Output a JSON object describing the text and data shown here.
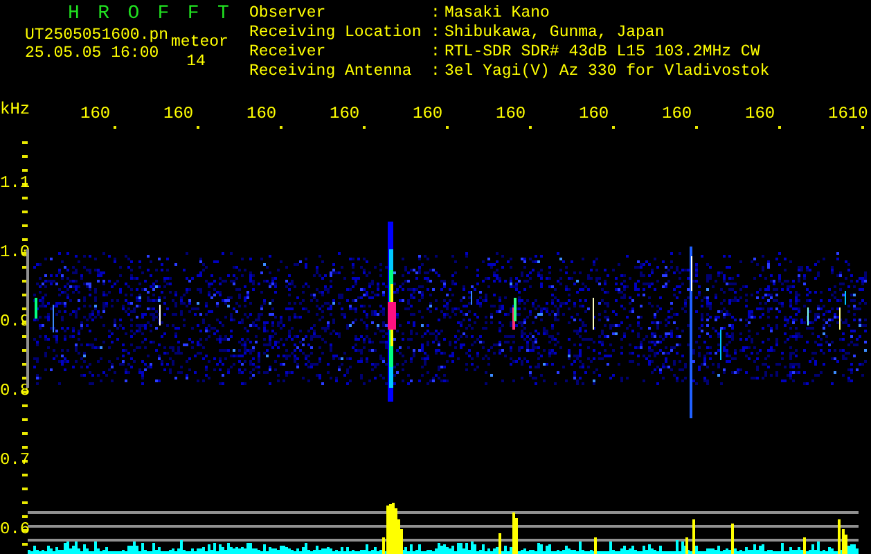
{
  "header": {
    "title": "H R O F F T",
    "file": "UT2505051600.pn",
    "mode": "meteor",
    "datetime": "25.05.05 16:00",
    "count": "14"
  },
  "info": [
    {
      "label": "Observer",
      "sep": ":",
      "value": "Masaki Kano"
    },
    {
      "label": "Receiving Location",
      "sep": ":",
      "value": "Shibukawa, Gunma, Japan"
    },
    {
      "label": "Receiver",
      "sep": ":",
      "value": "RTL-SDR SDR# 43dB L15 103.2MHz CW"
    },
    {
      "label": "Receiving Antenna",
      "sep": ":",
      "value": "3el Yagi(V) Az 330 for Vladivostok"
    }
  ],
  "plot": {
    "x_unit": "kHz",
    "x_labels": [
      "160",
      "160",
      "160",
      "160",
      "160",
      "160",
      "160",
      "160",
      "160",
      "1610"
    ],
    "y_labels": [
      "1.1",
      "1.0",
      "0.9",
      "0.8",
      "0.7",
      "0.6"
    ]
  }
}
